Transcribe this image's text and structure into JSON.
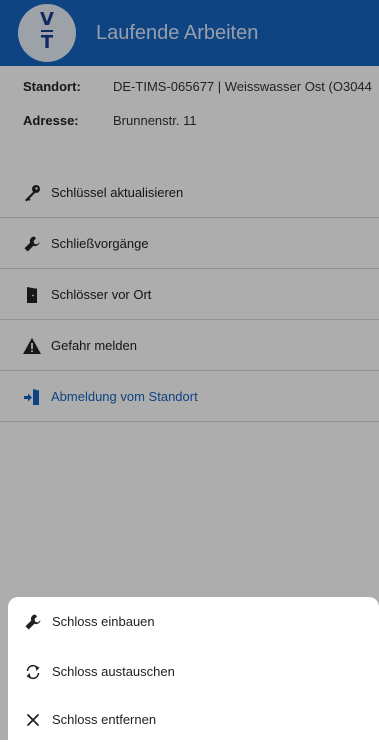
{
  "header": {
    "title": "Laufende Arbeiten",
    "logo_icon": "vt-logo",
    "logo_letters": [
      "V",
      "T"
    ],
    "color": "#1565c0"
  },
  "info": {
    "standort_label": "Standort:",
    "standort_value": "DE-TIMS-065677 | Weisswasser Ost (O3044",
    "adresse_label": "Adresse:",
    "adresse_value": "Brunnenstr. 11"
  },
  "menu": {
    "items": [
      {
        "label": "Schlüssel aktualisieren",
        "icon": "key-icon"
      },
      {
        "label": "Schließvorgänge",
        "icon": "wrench-icon"
      },
      {
        "label": "Schlösser vor Ort",
        "icon": "door-icon"
      },
      {
        "label": "Gefahr melden",
        "icon": "warning-icon"
      },
      {
        "label": "Abmeldung vom Standort",
        "icon": "logout-icon",
        "color": "#1565c0"
      }
    ]
  },
  "sheet": {
    "items": [
      {
        "label": "Schloss einbauen",
        "icon": "wrench-icon"
      },
      {
        "label": "Schloss austauschen",
        "icon": "swap-icon"
      },
      {
        "label": "Schloss entfernen",
        "icon": "close-icon"
      }
    ]
  }
}
